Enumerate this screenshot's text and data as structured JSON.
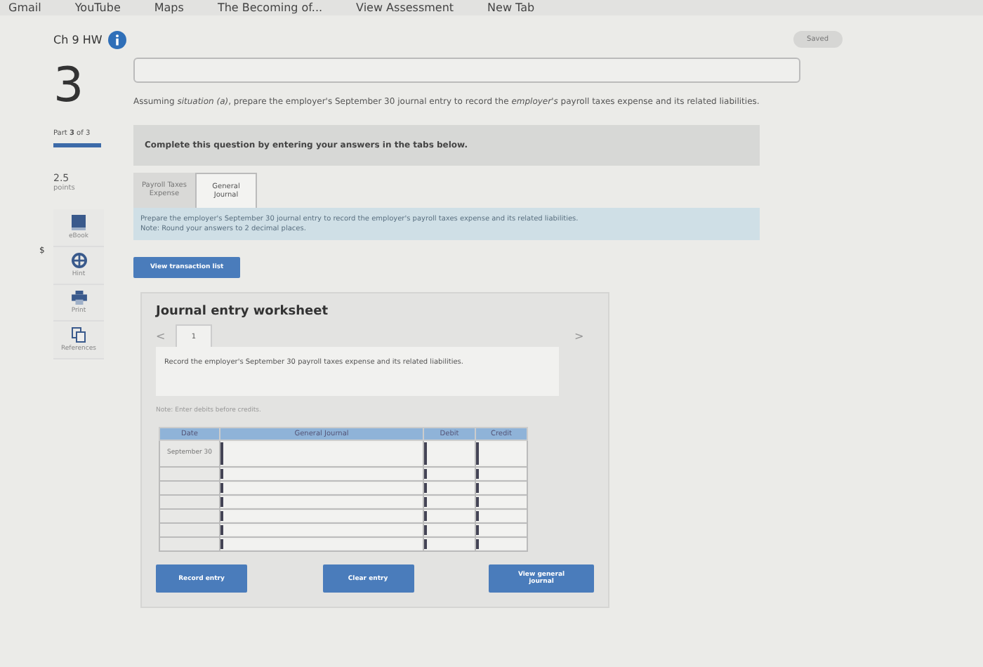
{
  "bookmarks": [
    "Gmail",
    "YouTube",
    "Maps",
    "The Becoming of...",
    "View Assessment",
    "New Tab"
  ],
  "header": {
    "title": "Ch 9 HW",
    "status": "Saved"
  },
  "sidebar": {
    "question_number": "3",
    "part": "Part **3** of 3",
    "points": "2.5",
    "points_label": "points",
    "currency_mark": "$",
    "tools": [
      {
        "kind": "book",
        "label": "eBook"
      },
      {
        "kind": "hint",
        "label": "Hint"
      },
      {
        "kind": "print",
        "label": "Print"
      },
      {
        "kind": "references",
        "label": "References"
      }
    ]
  },
  "question": "Assuming *situation (a)*, prepare the employer's September 30 journal entry to record the *employer's* payroll taxes expense and its related liabilities.",
  "instruction": "Complete this question by entering your answers in the tabs below.",
  "tabs": [
    {
      "label": "Payroll Taxes Expense",
      "selected": false
    },
    {
      "label": "General Journal",
      "selected": true
    }
  ],
  "tab_info": [
    "Prepare the employer's September 30 journal entry to record the employer's payroll taxes expense and its related liabilities.",
    "Note: Round your answers to 2 decimal places."
  ],
  "view_transactions_button": "View transaction list",
  "worksheet": {
    "title": "Journal entry worksheet",
    "prev": "<",
    "next": ">",
    "entry_tabs": [
      {
        "label": "1",
        "selected": true
      }
    ],
    "prompt": "Record the employer's September 30 payroll taxes expense and its related liabilities.",
    "note": "Note: Enter debits before credits.",
    "table": {
      "columns": [
        "Date",
        "General Journal",
        "Debit",
        "Credit"
      ],
      "rows": [
        {
          "date": "September 30"
        },
        {},
        {},
        {},
        {},
        {},
        {}
      ]
    },
    "buttons": [
      "Record entry",
      "Clear entry",
      "View general journal"
    ]
  }
}
